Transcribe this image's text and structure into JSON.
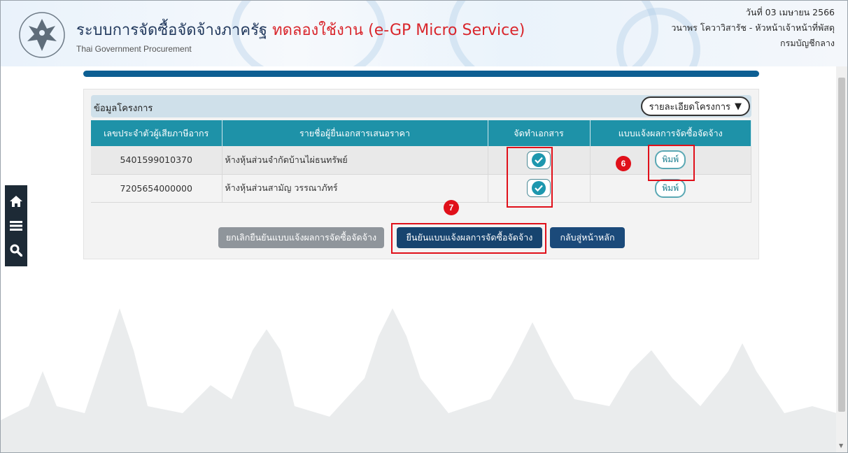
{
  "header": {
    "title": "ระบบการจัดซื้อจัดจ้างภาครัฐ",
    "trial": "ทดลองใช้งาน (e-GP Micro Service)",
    "subtitle": "Thai Government Procurement",
    "date": "วันที่ 03 เมษายน 2566",
    "user": "วนาพร โควาวิสารัช - หัวหน้าเจ้าหน้าที่พัสดุ",
    "org": "กรมบัญชีกลาง"
  },
  "sidebar": {
    "icons": [
      "home-icon",
      "menu-icon",
      "search-icon"
    ]
  },
  "panel": {
    "label": "ข้อมูลโครงการ",
    "detail_button": "รายละเอียดโครงการ",
    "columns": [
      "เลขประจำตัวผู้เสียภาษีอากร",
      "รายชื่อผู้ยื่นเอกสารเสนอราคา",
      "จัดทำเอกสาร",
      "แบบแจ้งผลการจัดซื้อจัดจ้าง"
    ],
    "rows": [
      {
        "tax_id": "5401599010370",
        "name": "ห้างหุ้นส่วนจำกัดบ้านไผ่ธนทรัพย์",
        "print": "พิมพ์"
      },
      {
        "tax_id": "7205654000000",
        "name": "ห้างหุ้นส่วนสามัญ วรรณาภัทร์",
        "print": "พิมพ์"
      }
    ]
  },
  "actions": {
    "cancel": "ยกเลิกยืนยันแบบแจ้งผลการจัดซื้อจัดจ้าง",
    "confirm": "ยืนยันแบบแจ้งผลการจัดซื้อจัดจ้าง",
    "back": "กลับสู่หน้าหลัก"
  },
  "markers": {
    "m6": "6",
    "m7": "7"
  },
  "colors": {
    "accent": "#1e92a8",
    "highlight": "#e0101a",
    "title": "#233a5e",
    "trial": "#d9262c"
  }
}
